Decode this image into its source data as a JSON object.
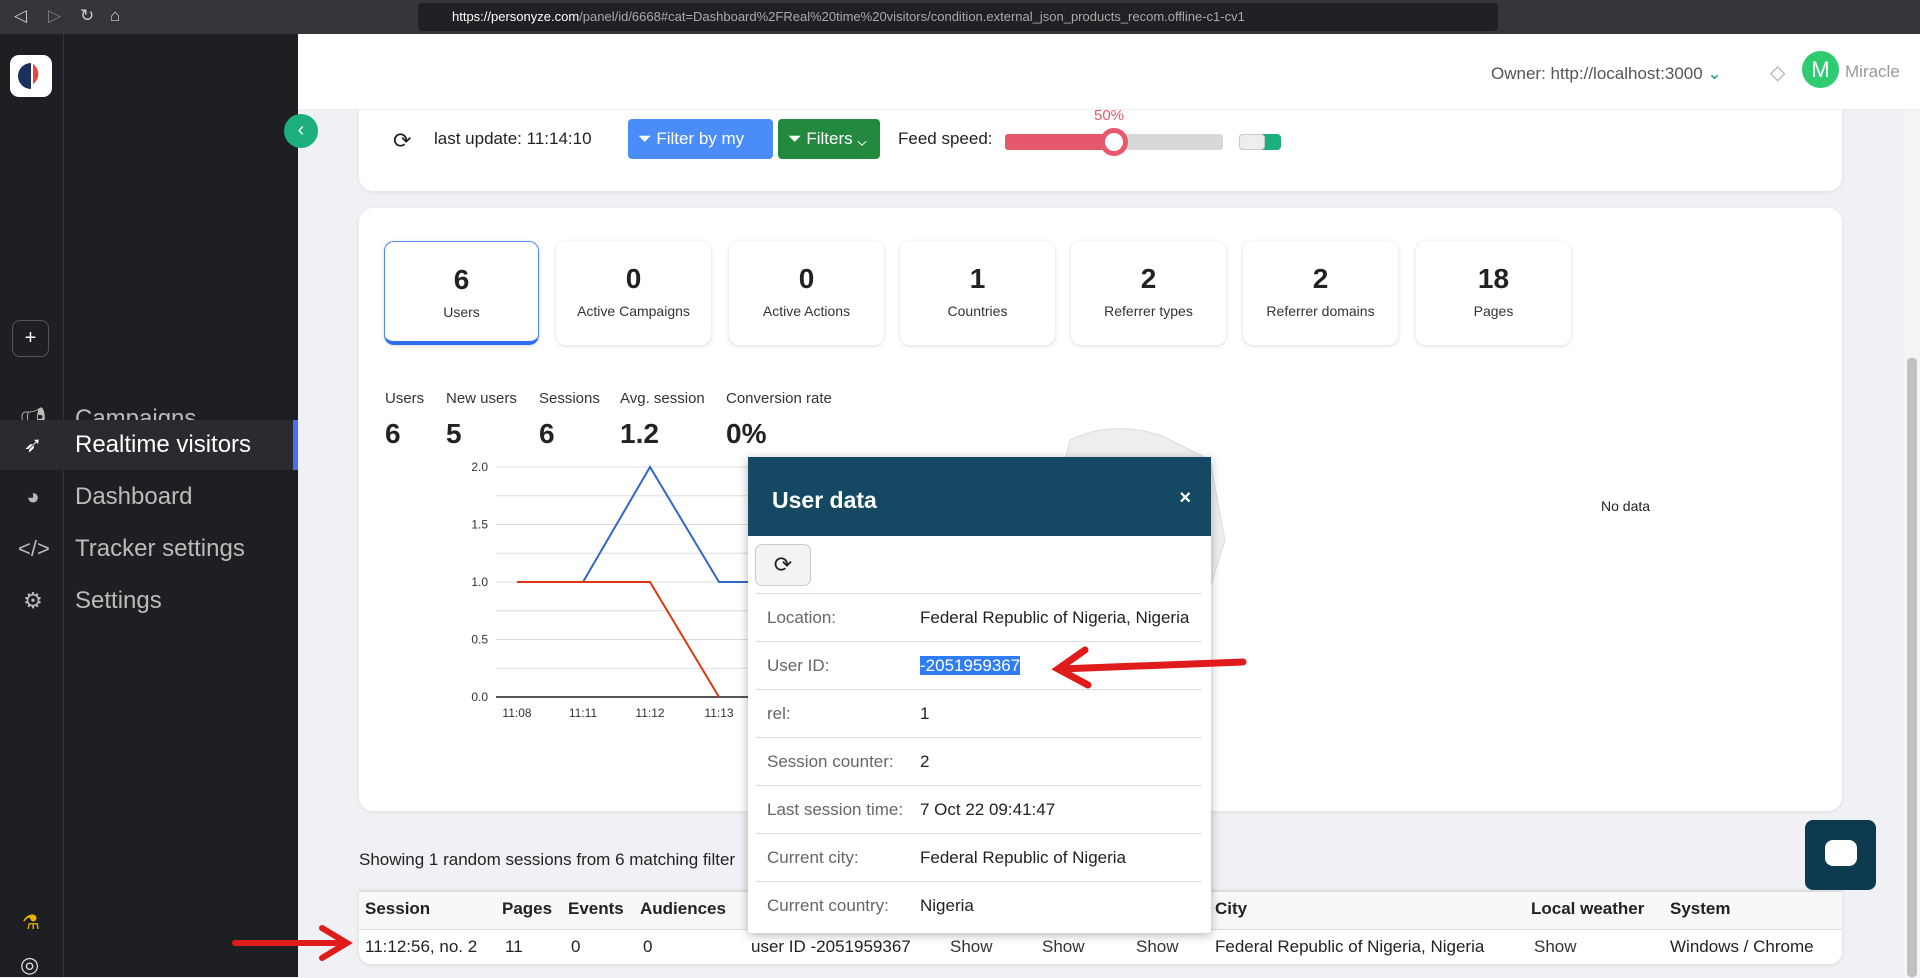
{
  "browser": {
    "url_host": "https://personyze.com",
    "url_path": "/panel/id/6668#cat=Dashboard%2FReal%20time%20visitors/condition.external_json_products_recom.offline-c1-cv1"
  },
  "sidebar": {
    "items": [
      {
        "label": "Campaigns",
        "icon": "megaphone-icon"
      },
      {
        "label": "Realtime visitors",
        "icon": "rocket-icon",
        "active": true
      },
      {
        "label": "Dashboard",
        "icon": "gauge-icon"
      },
      {
        "label": "Tracker settings",
        "icon": "code-icon"
      },
      {
        "label": "Settings",
        "icon": "gears-icon"
      }
    ]
  },
  "header": {
    "owner": "Owner: http://localhost:3000",
    "avatar_letter": "M",
    "user": "Miracle"
  },
  "toolbar": {
    "last_update": "last update: 11:14:10",
    "filter_ip": "Filter by my IP",
    "filters": "Filters",
    "feed_speed_label": "Feed speed:",
    "feed_speed_percent": 50,
    "feed_speed_text": "50%",
    "toggle_on": true
  },
  "tiles": [
    {
      "value": "6",
      "label": "Users",
      "active": true
    },
    {
      "value": "0",
      "label": "Active Campaigns"
    },
    {
      "value": "0",
      "label": "Active Actions"
    },
    {
      "value": "1",
      "label": "Countries"
    },
    {
      "value": "2",
      "label": "Referrer types"
    },
    {
      "value": "2",
      "label": "Referrer domains"
    },
    {
      "value": "18",
      "label": "Pages"
    }
  ],
  "metrics": [
    {
      "label": "Users",
      "value": "6"
    },
    {
      "label": "New users",
      "value": "5"
    },
    {
      "label": "Sessions",
      "value": "6"
    },
    {
      "label": "Avg. session",
      "value": "1.2"
    },
    {
      "label": "Conversion rate",
      "value": "0%"
    }
  ],
  "chart_data": {
    "type": "line",
    "categories": [
      "11:08",
      "11:11",
      "11:12",
      "11:13"
    ],
    "ylim": [
      0,
      2
    ],
    "yticks": [
      "0.0",
      "0.5",
      "1.0",
      "1.5",
      "2.0"
    ],
    "grid": true,
    "series": [
      {
        "color": "#3366cc",
        "values": [
          1,
          1,
          2,
          1
        ]
      },
      {
        "color": "#dc3912",
        "values": [
          1,
          1,
          1,
          0
        ]
      }
    ]
  },
  "map": {
    "no_data": "No data"
  },
  "modal": {
    "title": "User data",
    "close": "×",
    "rows": [
      {
        "k": "Location:",
        "v": "Federal Republic of Nigeria, Nigeria"
      },
      {
        "k": "User ID:",
        "v": "-2051959367"
      },
      {
        "k": "rel:",
        "v": "1"
      },
      {
        "k": "Session counter:",
        "v": "2"
      },
      {
        "k": "Last session time:",
        "v": "7 Oct 22 09:41:47"
      },
      {
        "k": "Current city:",
        "v": "Federal Republic of Nigeria"
      },
      {
        "k": "Current country:",
        "v": "Nigeria"
      }
    ]
  },
  "sessions": {
    "showing": "Showing 1 random sessions from 6 matching filter",
    "headers": [
      "Session",
      "Pages",
      "Events",
      "Audiences",
      "City",
      "Local weather",
      "System"
    ],
    "row": {
      "session": "11:12:56, no. 2",
      "pages": "11",
      "events": "0",
      "audiences": "0",
      "user": "user ID -2051959367",
      "show1": "Show",
      "show2": "Show",
      "show3": "Show",
      "city": "Federal Republic of Nigeria, Nigeria",
      "weather": "Show",
      "system": "Windows / Chrome"
    }
  }
}
